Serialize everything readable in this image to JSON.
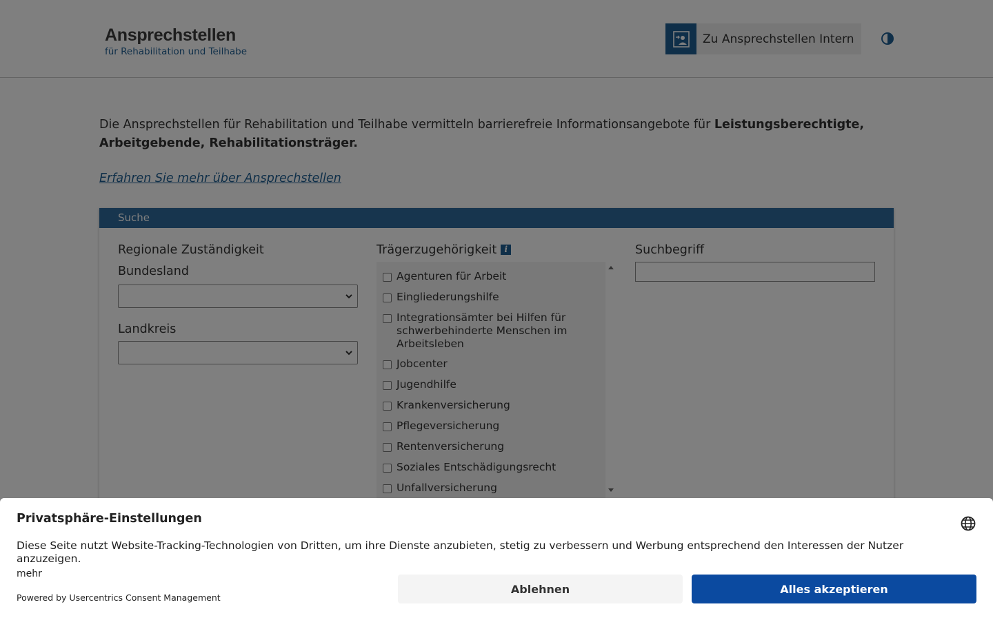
{
  "header": {
    "logo_title": "Ansprechstellen",
    "logo_subtitle": "für Rehabilitation und Teilhabe",
    "intern_button_label": "Zu Ansprechstellen Intern"
  },
  "intro": {
    "text_start": "Die Ansprechstellen für Rehabilitation und Teilhabe vermitteln barrierefreie Informationsangebote für ",
    "text_bold": "Leistungsberechtigte, Arbeitgebende, Rehabilitationsträger.",
    "more_link": "Erfahren Sie mehr über Ansprechstellen"
  },
  "search": {
    "header": "Suche",
    "regional": {
      "title": "Regionale Zuständigkeit",
      "bundesland_label": "Bundesland",
      "bundesland_value": "",
      "landkreis_label": "Landkreis",
      "landkreis_value": ""
    },
    "traeger": {
      "title": "Trägerzugehörigkeit",
      "info_icon": "i",
      "options": [
        "Agenturen für Arbeit",
        "Eingliederungshilfe",
        "Integrationsämter bei Hilfen für schwerbehinderte Menschen im Arbeitsleben",
        "Jobcenter",
        "Jugendhilfe",
        "Krankenversicherung",
        "Pflegeversicherung",
        "Rentenversicherung",
        "Soziales Entschädigungsrecht",
        "Unfallversicherung"
      ]
    },
    "keyword": {
      "title": "Suchbegriff",
      "value": ""
    }
  },
  "consent": {
    "title": "Privatsphäre-Einstellungen",
    "text": "Diese Seite nutzt Website-Tracking-Technologien von Dritten, um ihre Dienste anzubieten, stetig zu verbessern und Werbung entsprechend den Interessen der Nutzer anzuzeigen.",
    "more": "mehr",
    "powered_by": "Powered by Usercentrics Consent Management",
    "reject_label": "Ablehnen",
    "accept_label": "Alles akzeptieren",
    "accept_color": "#0b4aa0"
  },
  "colors": {
    "brand_blue": "#1f5f93",
    "panel_header": "#2f6a9c"
  }
}
